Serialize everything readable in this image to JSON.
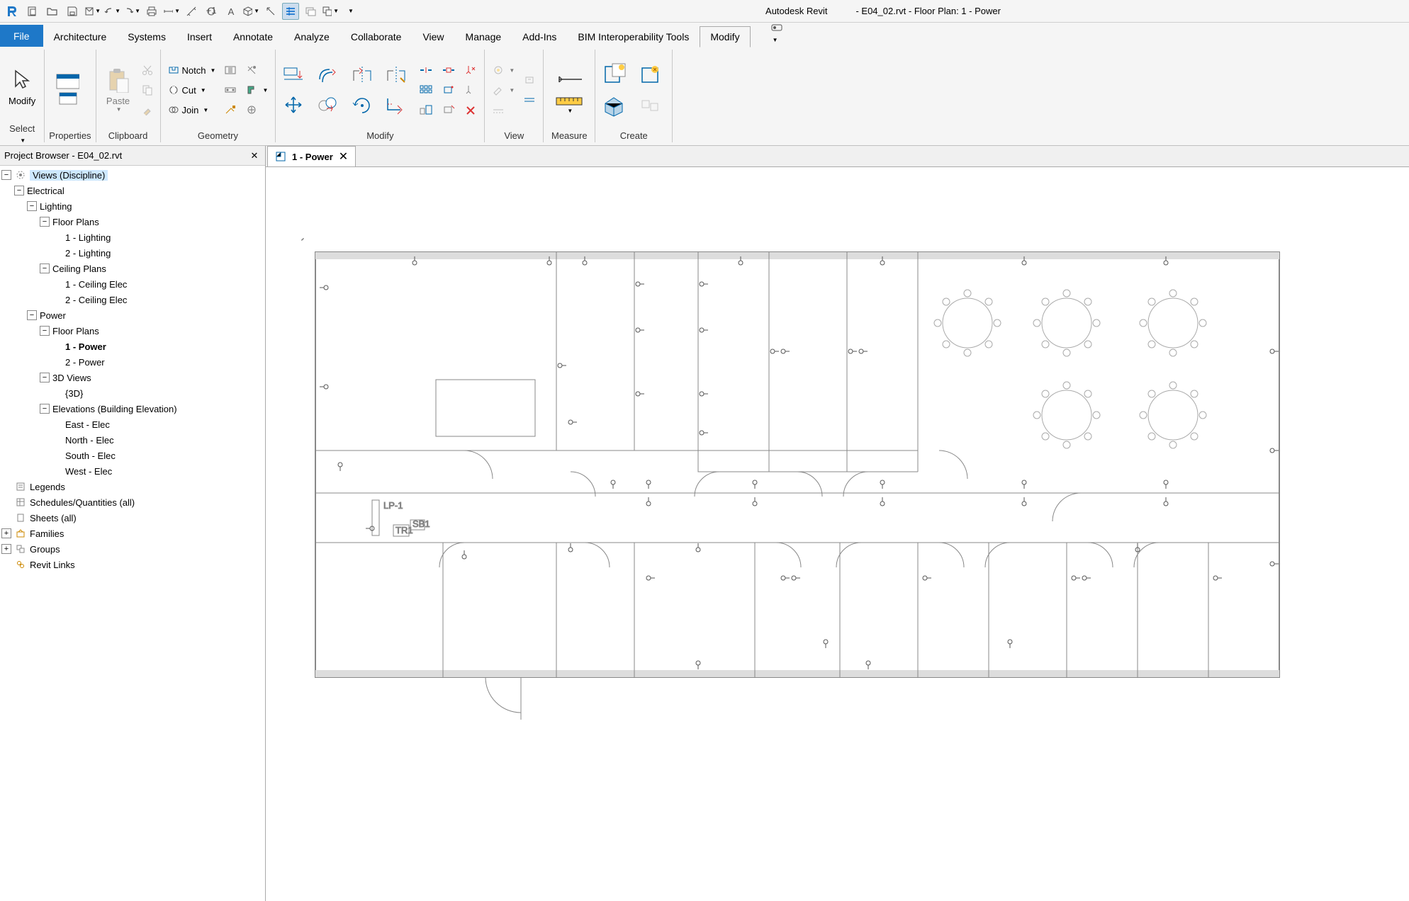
{
  "app": {
    "name": "Autodesk Revit",
    "doc": "- E04_02.rvt - Floor Plan: 1 - Power"
  },
  "ribbon_tabs": [
    "File",
    "Architecture",
    "Systems",
    "Insert",
    "Annotate",
    "Analyze",
    "Collaborate",
    "View",
    "Manage",
    "Add-Ins",
    "BIM Interoperability Tools",
    "Modify"
  ],
  "active_tab": "Modify",
  "groups": {
    "select": "Select",
    "properties": "Properties",
    "clipboard": "Clipboard",
    "geometry": "Geometry",
    "modify": "Modify",
    "view": "View",
    "measure": "Measure",
    "create": "Create"
  },
  "geom": {
    "notch": "Notch",
    "cut": "Cut",
    "join": "Join"
  },
  "bigbtns": {
    "modify": "Modify",
    "paste": "Paste"
  },
  "browser": {
    "title": "Project Browser - E04_02.rvt",
    "views_root": "Views (Discipline)",
    "electrical": "Electrical",
    "lighting": "Lighting",
    "floor_plans": "Floor Plans",
    "l1": "1 - Lighting",
    "l2": "2 - Lighting",
    "ceiling_plans": "Ceiling Plans",
    "c1": "1 - Ceiling Elec",
    "c2": "2 - Ceiling Elec",
    "power": "Power",
    "p1": "1 - Power",
    "p2": "2 - Power",
    "3d": "3D Views",
    "3d1": "{3D}",
    "elev": "Elevations (Building Elevation)",
    "e1": "East - Elec",
    "e2": "North - Elec",
    "e3": "South - Elec",
    "e4": "West - Elec",
    "legends": "Legends",
    "schedules": "Schedules/Quantities (all)",
    "sheets": "Sheets (all)",
    "families": "Families",
    "groups_n": "Groups",
    "revitlinks": "Revit Links"
  },
  "viewtab": {
    "name": "1 - Power"
  },
  "plan_labels": {
    "lp1": "LP-1",
    "tr1": "TR1",
    "sb1": "SB1"
  }
}
